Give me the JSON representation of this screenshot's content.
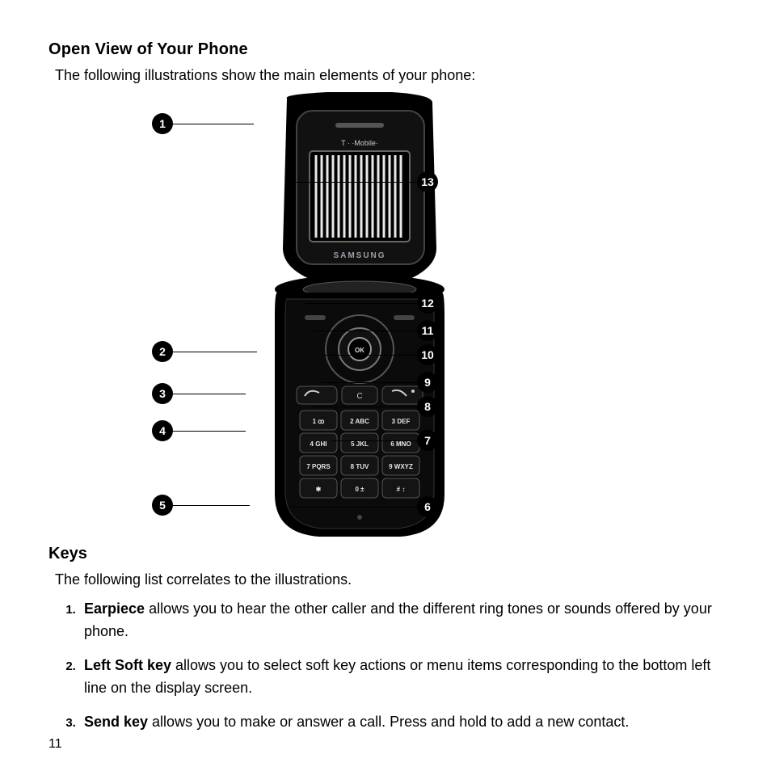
{
  "heading": "Open View of Your Phone",
  "intro": "The following illustrations show the main elements of your phone:",
  "keys_heading": "Keys",
  "keys_intro": "The following list correlates to the illustrations.",
  "page_number": "11",
  "illustration": {
    "carrier": "T · ·Mobile·",
    "brand": "SAMSUNG",
    "nav_center": "OK",
    "keypad": {
      "r1": [
        "1 ꝏ",
        "2 ABC",
        "3 DEF"
      ],
      "r2": [
        "4 GHI",
        "5 JKL",
        "6 MNO"
      ],
      "r3": [
        "7 PQRS",
        "8 TUV",
        "9 WXYZ"
      ],
      "r4": [
        "✱",
        "0 ±",
        "# ↕"
      ]
    }
  },
  "callouts": [
    {
      "n": "1"
    },
    {
      "n": "2"
    },
    {
      "n": "3"
    },
    {
      "n": "4"
    },
    {
      "n": "5"
    },
    {
      "n": "6"
    },
    {
      "n": "7"
    },
    {
      "n": "8"
    },
    {
      "n": "9"
    },
    {
      "n": "10"
    },
    {
      "n": "11"
    },
    {
      "n": "12"
    },
    {
      "n": "13"
    }
  ],
  "keys_list": [
    {
      "term": "Earpiece",
      "desc": " allows you to hear the other caller and the different ring tones or sounds offered by your phone."
    },
    {
      "term": "Left Soft key",
      "desc": " allows you to select soft key actions or menu items corresponding to the bottom left line on the display screen."
    },
    {
      "term": "Send key",
      "desc": " allows you to make or answer a call. Press and hold to add a new contact."
    }
  ]
}
